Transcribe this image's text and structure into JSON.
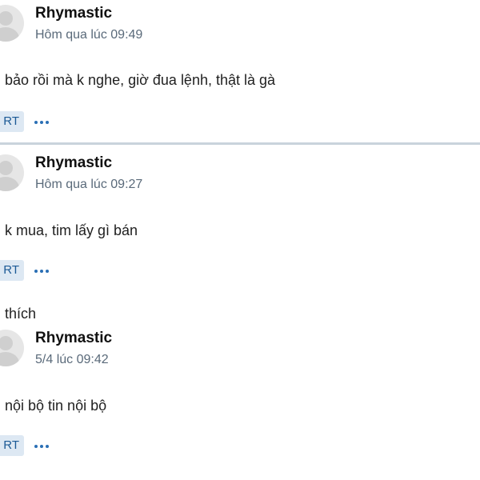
{
  "posts": [
    {
      "username": "Rhymastic",
      "timestamp": "Hôm qua lúc 09:49",
      "content": "bảo rồi mà k nghe, giờ đua lệnh, thật là gà",
      "action_label": "RT"
    },
    {
      "username": "Rhymastic",
      "timestamp": "Hôm qua lúc 09:27",
      "content": "k mua, tim lấy gì bán",
      "action_label": "RT",
      "footer_text": "thích"
    },
    {
      "username": "Rhymastic",
      "timestamp": "5/4 lúc 09:42",
      "content": "nội bộ tin nội bộ",
      "action_label": "RT"
    }
  ],
  "colors": {
    "accent": "#2a6fb5",
    "badge_bg": "#dde8f3",
    "divider": "#c9d3dc"
  },
  "icons": {
    "avatar": "avatar-placeholder-icon",
    "more": "more-dots-icon"
  }
}
